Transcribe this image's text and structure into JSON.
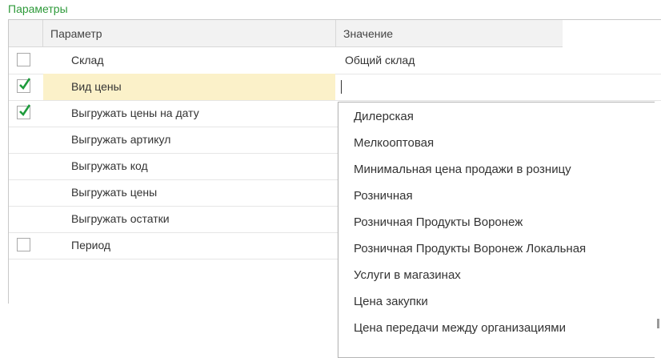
{
  "panel": {
    "title": "Параметры"
  },
  "table": {
    "headers": {
      "param": "Параметр",
      "value": "Значение"
    },
    "rows": [
      {
        "label": "Склад",
        "checkbox": "unchecked",
        "value": "Общий склад"
      },
      {
        "label": "Вид цены",
        "checkbox": "checked",
        "value": ""
      },
      {
        "label": "Выгружать цены на дату",
        "checkbox": "checked",
        "value": ""
      },
      {
        "label": "Выгружать артикул",
        "checkbox": "none",
        "value": ""
      },
      {
        "label": "Выгружать код",
        "checkbox": "none",
        "value": ""
      },
      {
        "label": "Выгружать цены",
        "checkbox": "none",
        "value": ""
      },
      {
        "label": "Выгружать остатки",
        "checkbox": "none",
        "value": ""
      },
      {
        "label": "Период",
        "checkbox": "unchecked",
        "value": ""
      }
    ]
  },
  "dropdown": {
    "options": [
      "Дилерская",
      "Мелкооптовая",
      "Минимальная цена продажи в розницу",
      "Розничная",
      "Розничная Продукты Воронеж",
      "Розничная Продукты Воронеж Локальная",
      "Услуги в магазинах",
      "Цена закупки",
      "Цена передачи между организациями"
    ]
  },
  "colors": {
    "accent_title": "#2e9a3a",
    "check_mark": "#1e9b3c",
    "selected_row": "#fbf1c9"
  }
}
